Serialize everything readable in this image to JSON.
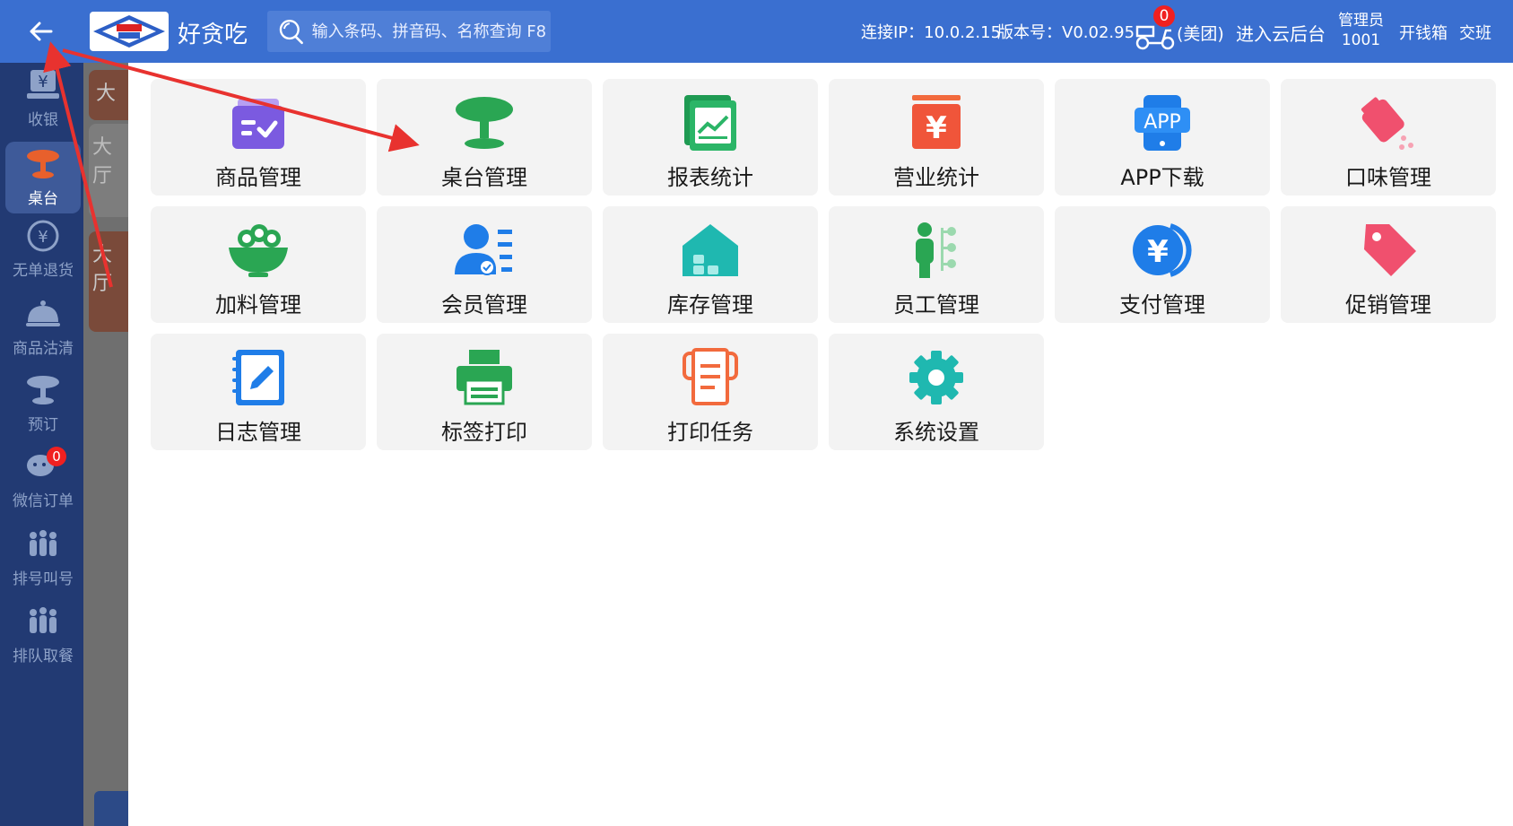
{
  "topbar": {
    "app_name": "好贪吃",
    "search_placeholder": "输入条码、拼音码、名称查询 F8",
    "ip_label": "连接IP：10.0.2.15",
    "version_label": "版本号：V0.02.95",
    "delivery_count": "0",
    "meituan": "(美团)",
    "cloud": "进入云后台",
    "admin_role": "管理员",
    "admin_id": "1001",
    "cash_box": "开钱箱",
    "shift": "交班"
  },
  "sidebar": {
    "items": [
      {
        "label": "收银",
        "icon": "cashier-icon"
      },
      {
        "label": "桌台",
        "icon": "table-icon",
        "active": true
      },
      {
        "label": "无单退货",
        "icon": "refund-icon"
      },
      {
        "label": "商品沽清",
        "icon": "bell-icon"
      },
      {
        "label": "预订",
        "icon": "reserve-icon"
      },
      {
        "label": "微信订单",
        "icon": "wechat-order-icon",
        "badge": "0"
      },
      {
        "label": "排号叫号",
        "icon": "queue-call-icon"
      },
      {
        "label": "排队取餐",
        "icon": "queue-pickup-icon"
      }
    ]
  },
  "dimcol": {
    "labels": [
      "大",
      "大厅",
      "大厅"
    ]
  },
  "tiles": [
    {
      "label": "商品管理",
      "icon": "product-icon"
    },
    {
      "label": "桌台管理",
      "icon": "table-manage-icon"
    },
    {
      "label": "报表统计",
      "icon": "report-icon"
    },
    {
      "label": "营业统计",
      "icon": "revenue-icon"
    },
    {
      "label": "APP下载",
      "icon": "app-download-icon",
      "icon_text": "APP"
    },
    {
      "label": "口味管理",
      "icon": "flavor-icon"
    },
    {
      "label": "加料管理",
      "icon": "topping-icon"
    },
    {
      "label": "会员管理",
      "icon": "member-icon"
    },
    {
      "label": "库存管理",
      "icon": "inventory-icon"
    },
    {
      "label": "员工管理",
      "icon": "staff-icon"
    },
    {
      "label": "支付管理",
      "icon": "payment-icon"
    },
    {
      "label": "促销管理",
      "icon": "promotion-icon"
    },
    {
      "label": "日志管理",
      "icon": "log-icon"
    },
    {
      "label": "标签打印",
      "icon": "label-print-icon"
    },
    {
      "label": "打印任务",
      "icon": "print-task-icon"
    },
    {
      "label": "系统设置",
      "icon": "settings-icon"
    }
  ],
  "colors": {
    "topbar": "#3a6fd0",
    "sidebar": "#223a73",
    "tile_bg": "#f3f3f3",
    "arrow": "#e8322f"
  }
}
